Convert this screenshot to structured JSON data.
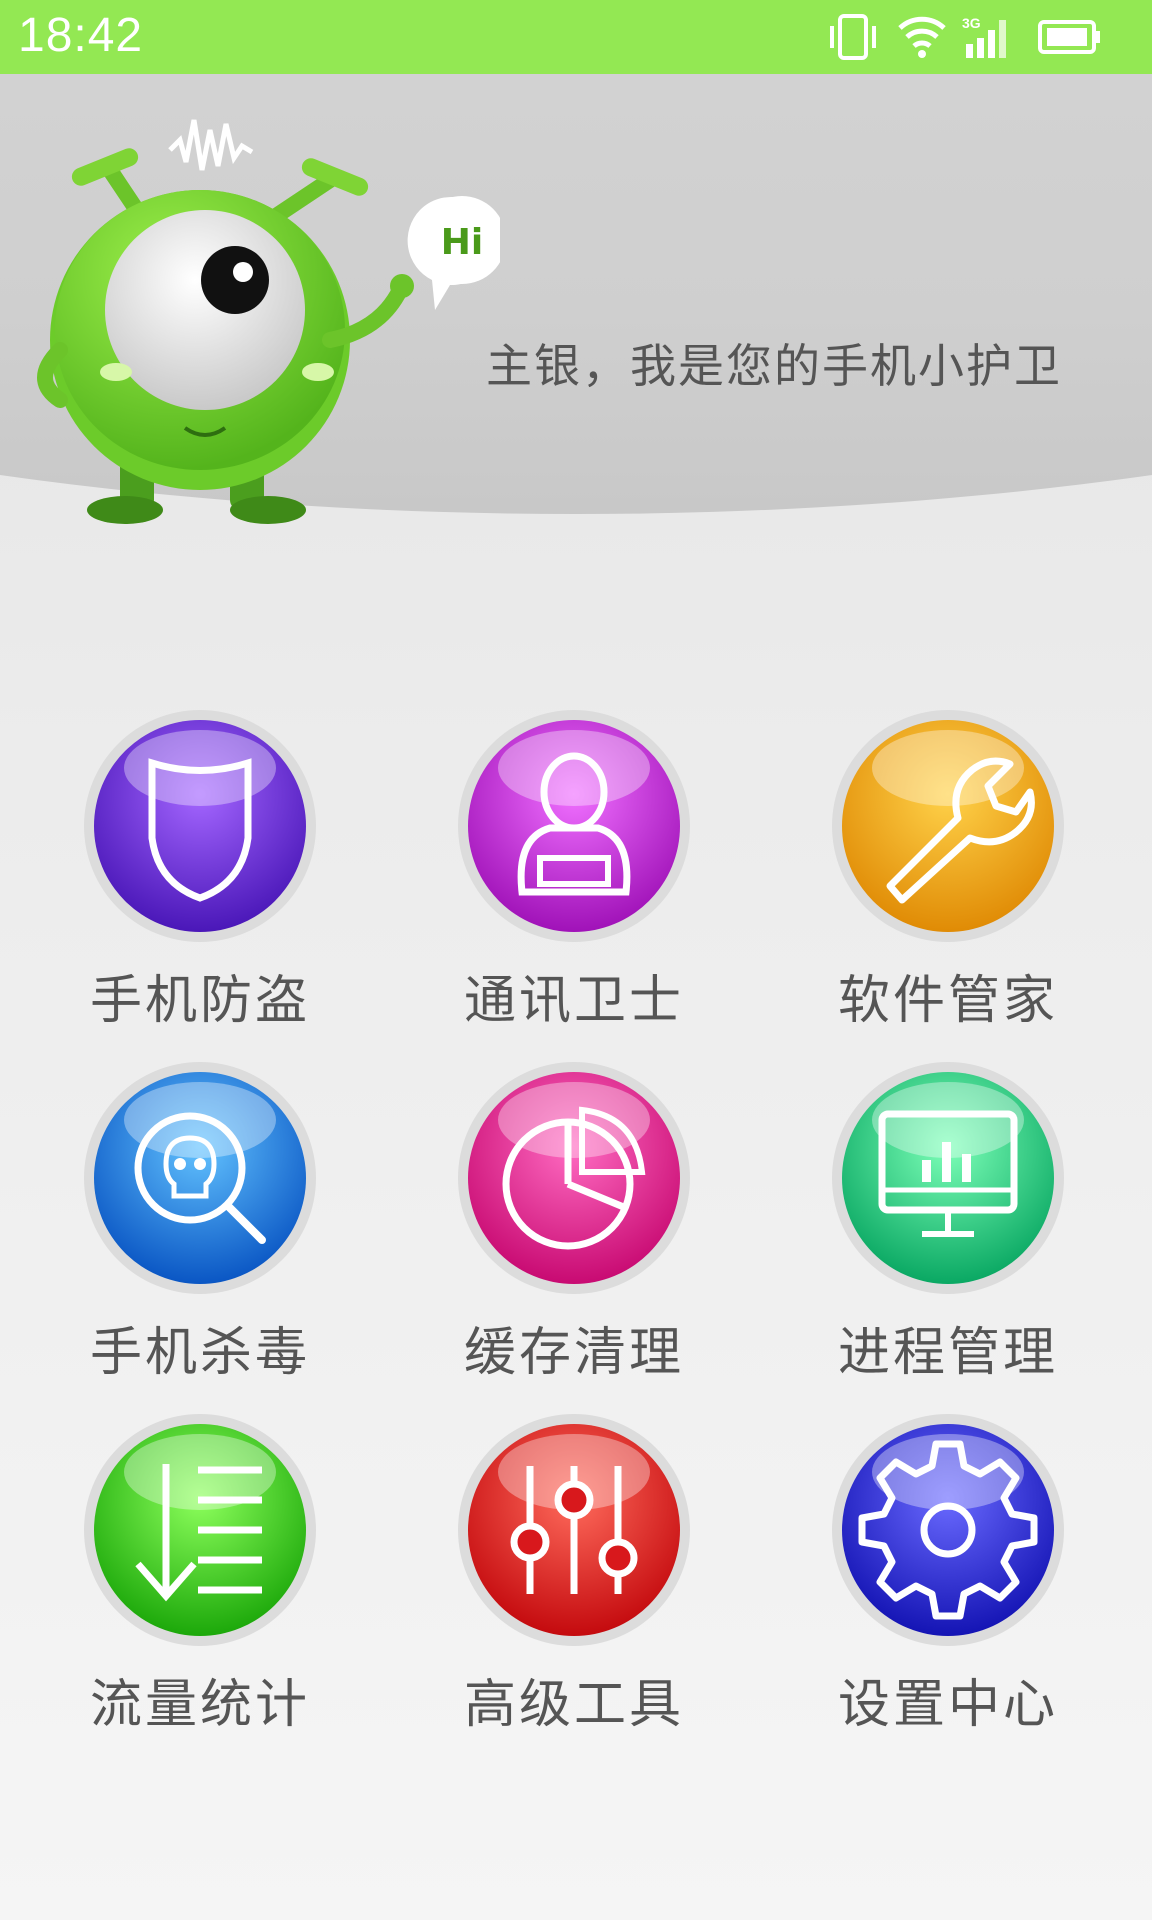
{
  "status_bar": {
    "time": "18:42",
    "network_label": "3G"
  },
  "header": {
    "greeting": "主银，我是您的手机小护卫",
    "speech_bubble": "Hi"
  },
  "menu": [
    {
      "label": "手机防盗",
      "icon": "shield-icon",
      "color": "#6b2bd9"
    },
    {
      "label": "通讯卫士",
      "icon": "contact-icon",
      "color": "#c21fd0"
    },
    {
      "label": "软件管家",
      "icon": "wrench-icon",
      "color": "#f0a20f"
    },
    {
      "label": "手机杀毒",
      "icon": "virus-scan-icon",
      "color": "#1a73db"
    },
    {
      "label": "缓存清理",
      "icon": "pie-chart-icon",
      "color": "#e0188a"
    },
    {
      "label": "进程管理",
      "icon": "monitor-icon",
      "color": "#18c77a"
    },
    {
      "label": "流量统计",
      "icon": "traffic-list-icon",
      "color": "#2bcc1a"
    },
    {
      "label": "高级工具",
      "icon": "sliders-icon",
      "color": "#d8181c"
    },
    {
      "label": "设置中心",
      "icon": "gear-icon",
      "color": "#2424cc"
    }
  ]
}
